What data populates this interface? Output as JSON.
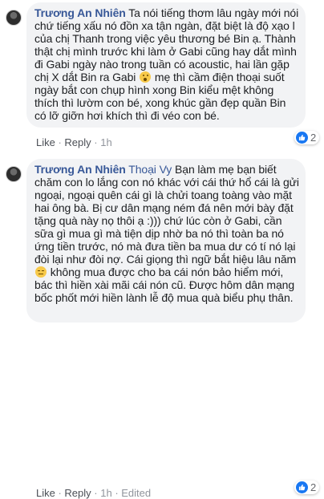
{
  "comments": [
    {
      "author": "Trương An Nhiên",
      "text_1": "Ta nói tiếng thơm lâu ngày mới nói chứ tiếng xấu nó đồn xa tận ngàn, đặt biệt là độ xạo l của chị Thanh trong việc yêu thương bé Bin ạ. Thành thật chị mình trước khi làm ở Gabi cũng hay dắt mình đi Gabi ngày nào trong tuần có acoustic, hai lần gặp chị X dắt Bin ra Gabi",
      "emoji_1": "face-with-open-mouth",
      "text_2": "mẹ thì cầm điện thoại suốt ngày bắt con chụp hình xong Bin kiểu mệt không thích thì lườm con bé, xong khúc gần đẹp quần Bin có lỡ giỡn hơi khích thì đi véo con bé.",
      "actions": {
        "like": "Like",
        "reply": "Reply",
        "time": "1h"
      },
      "reaction_icon": "like-icon",
      "reaction_count": "2"
    },
    {
      "author": "Trương An Nhiên",
      "tag": "Thoại Vy",
      "text_1": "Bạn làm mẹ bạn biết chăm con lo lắng con nó khác với cái thứ hổ cái là gửi ngoại, ngoại quên cái gì là chửi toang toàng vào mặt hai ông bà. Bị cư dân mạng ném đá nên mới bày đặt tặng quà này nọ thôi ạ :))) chứ lúc còn ở Gabi, cần sữa gì mua gì mà tiện dịp nhờ ba nó thì toàn ba nó ứng tiền trước, nó mà đưa tiền ba mua dư có tí nó lại đòi lại như đòi nợ. Cái giọng thì ngữ bắt hiệu lâu năm",
      "emoji_1": "pensive-face",
      "text_2": "không mua được cho ba cái nón bảo hiểm mới, bác thì hiền xài mãi cái nón cũ. Được hôm dân mạng bốc phốt mới hiền lành lễ độ mua quà biểu phụ thân.",
      "actions": {
        "like": "Like",
        "reply": "Reply",
        "time": "1h",
        "edited": "Edited"
      },
      "reaction_icon": "like-icon",
      "reaction_count": "2"
    }
  ],
  "colors": {
    "author": "#385898",
    "bubble": "#f2f3f5",
    "meta": "#90949c",
    "like_blue": "#1877f2"
  }
}
